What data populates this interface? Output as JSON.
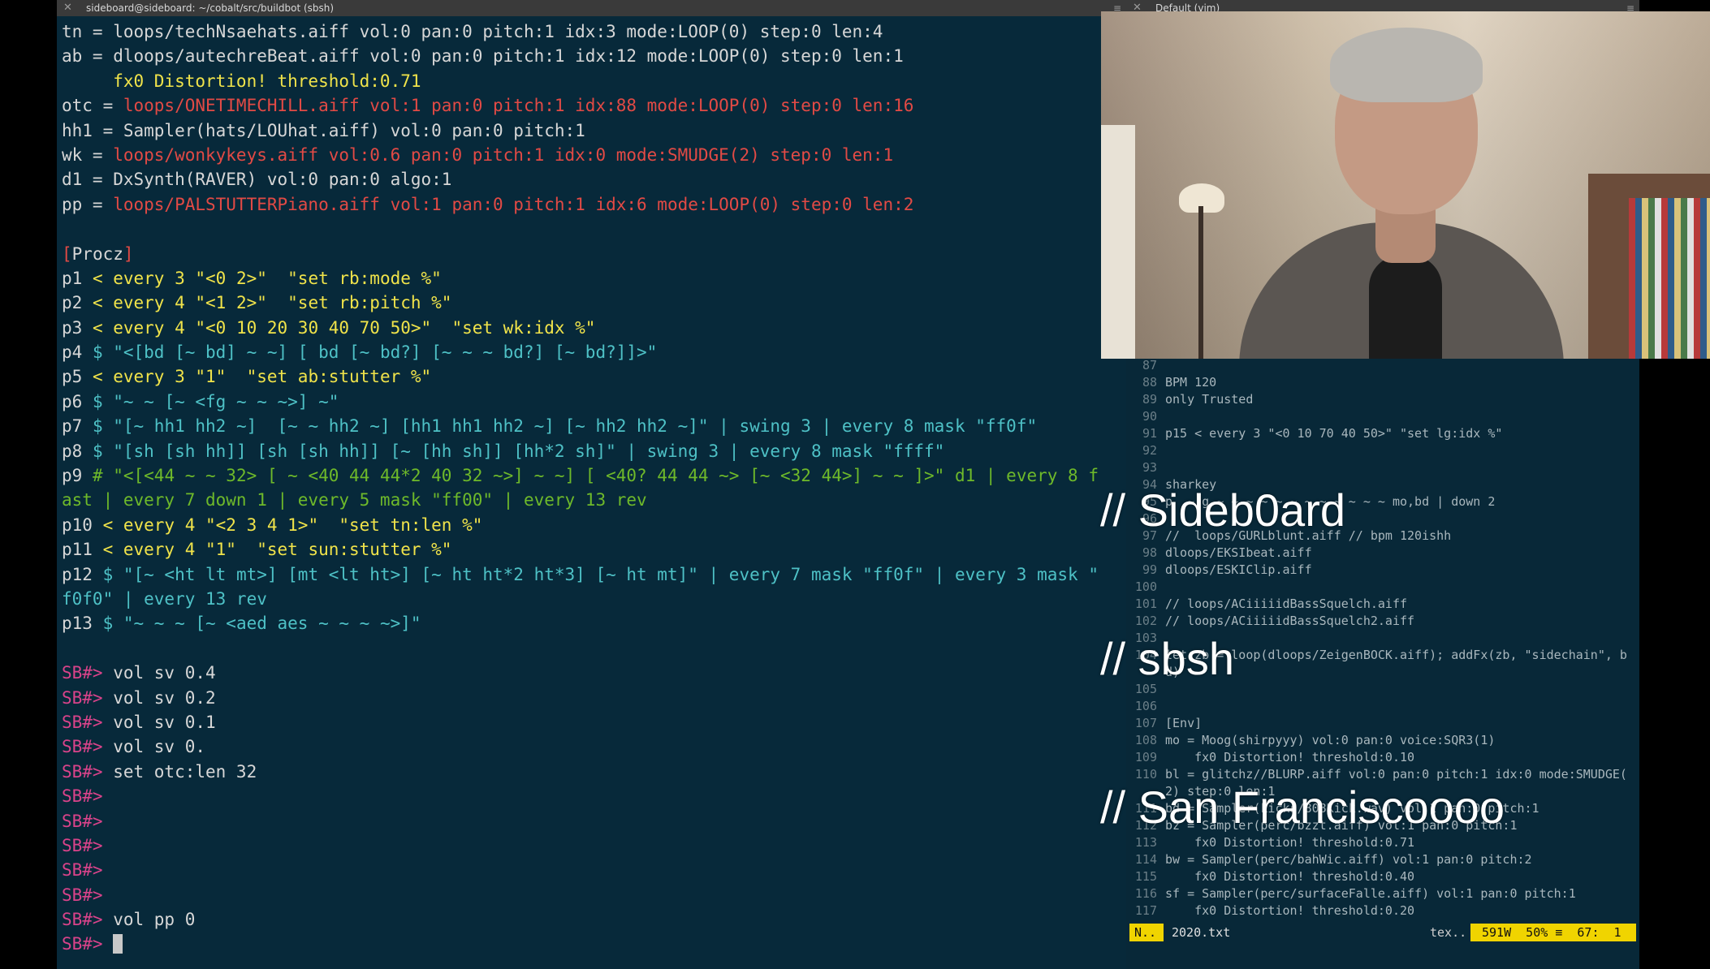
{
  "terminal": {
    "title": "sideboard@sideboard: ~/cobalt/src/buildbot (sbsh)",
    "lines": [
      [
        {
          "t": "tn = ",
          "c": "w"
        },
        {
          "t": "loops/techNsaehats.aiff vol:0 pan:0 pitch:1 idx:3 mode:LOOP(0) step:0 len:4",
          "c": "w"
        }
      ],
      [
        {
          "t": "ab = ",
          "c": "w"
        },
        {
          "t": "dloops/autechreBeat.aiff vol:0 pan:0 pitch:1 idx:12 mode:LOOP(0) step:0 len:1",
          "c": "w"
        }
      ],
      [
        {
          "t": "     fx0 Distortion! threshold:0.71",
          "c": "y"
        }
      ],
      [
        {
          "t": "otc = ",
          "c": "w"
        },
        {
          "t": "loops/ONETIMECHILL.aiff vol:1 pan:0 pitch:1 idx:88 mode:LOOP(0) step:0 len:16",
          "c": "r"
        }
      ],
      [
        {
          "t": "hh1 = Sampler(hats/LOUhat.aiff) vol:0 pan:0 pitch:1",
          "c": "w"
        }
      ],
      [
        {
          "t": "wk = ",
          "c": "w"
        },
        {
          "t": "loops/wonkykeys.aiff vol:0.6 pan:0 pitch:1 idx:0 mode:SMUDGE(2) step:0 len:1",
          "c": "r"
        }
      ],
      [
        {
          "t": "d1 = DxSynth(RAVER) vol:0 pan:0 algo:1",
          "c": "w"
        }
      ],
      [
        {
          "t": "pp = ",
          "c": "w"
        },
        {
          "t": "loops/PALSTUTTERPiano.aiff vol:1 pan:0 pitch:1 idx:6 mode:LOOP(0) step:0 len:2",
          "c": "r"
        }
      ],
      [
        {
          "t": "",
          "c": "w"
        }
      ],
      [
        {
          "t": "[",
          "c": "r"
        },
        {
          "t": "Procz",
          "c": "w"
        },
        {
          "t": "]",
          "c": "r"
        }
      ],
      [
        {
          "t": "p1 ",
          "c": "w"
        },
        {
          "t": "< every 3 \"<0 2>\"  \"set rb:mode %\"",
          "c": "y"
        }
      ],
      [
        {
          "t": "p2 ",
          "c": "w"
        },
        {
          "t": "< every 4 \"<1 2>\"  \"set rb:pitch %\"",
          "c": "y"
        }
      ],
      [
        {
          "t": "p3 ",
          "c": "w"
        },
        {
          "t": "< every 4 \"<0 10 20 30 40 70 50>\"  \"set wk:idx %\"",
          "c": "y"
        }
      ],
      [
        {
          "t": "p4 ",
          "c": "w"
        },
        {
          "t": "$ \"<[bd [~ bd] ~ ~] [ bd [~ bd?] [~ ~ ~ bd?] [~ bd?]]>\"",
          "c": "c"
        }
      ],
      [
        {
          "t": "p5 ",
          "c": "w"
        },
        {
          "t": "< every 3 \"1\"  \"set ab:stutter %\"",
          "c": "y"
        }
      ],
      [
        {
          "t": "p6 ",
          "c": "w"
        },
        {
          "t": "$ \"~ ~ [~ <fg ~ ~ ~>] ~\"",
          "c": "c"
        }
      ],
      [
        {
          "t": "p7 ",
          "c": "w"
        },
        {
          "t": "$ \"[~ hh1 hh2 ~]  [~ ~ hh2 ~] [hh1 hh1 hh2 ~] [~ hh2 hh2 ~]\" | swing 3 | every 8 mask \"ff0f\"",
          "c": "c"
        }
      ],
      [
        {
          "t": "p8 ",
          "c": "w"
        },
        {
          "t": "$ \"[sh [sh hh]] [sh [sh hh]] [~ [hh sh]] [hh*2 sh]\" | swing 3 | every 8 mask \"ffff\"",
          "c": "c"
        }
      ],
      [
        {
          "t": "p9 ",
          "c": "w"
        },
        {
          "t": "# \"<[<44 ~ ~ 32> [ ~ <40 44 44*2 40 32 ~>] ~ ~] [ <40? 44 44 ~> [~ <32 44>] ~ ~ ]>\" d1 | every 8 f",
          "c": "g"
        }
      ],
      [
        {
          "t": "ast | every 7 down 1 | every 5 mask \"ff00\" | every 13 rev",
          "c": "g"
        }
      ],
      [
        {
          "t": "p10 ",
          "c": "w"
        },
        {
          "t": "< every 4 \"<2 3 4 1>\"  \"set tn:len %\"",
          "c": "y"
        }
      ],
      [
        {
          "t": "p11 ",
          "c": "w"
        },
        {
          "t": "< every 4 \"1\"  \"set sun:stutter %\"",
          "c": "y"
        }
      ],
      [
        {
          "t": "p12 ",
          "c": "w"
        },
        {
          "t": "$ \"[~ <ht lt mt>] [mt <lt ht>] [~ ht ht*2 ht*3] [~ ht mt]\" | every 7 mask \"ff0f\" | every 3 mask \"",
          "c": "c"
        }
      ],
      [
        {
          "t": "f0f0\" | every 13 rev",
          "c": "c"
        }
      ],
      [
        {
          "t": "p13 ",
          "c": "w"
        },
        {
          "t": "$ \"~ ~ ~ [~ <aed aes ~ ~ ~ ~>]\"",
          "c": "c"
        }
      ],
      [
        {
          "t": "",
          "c": "w"
        }
      ],
      [
        {
          "t": "SB#> ",
          "c": "p"
        },
        {
          "t": "vol sv 0.4",
          "c": "w"
        }
      ],
      [
        {
          "t": "SB#> ",
          "c": "p"
        },
        {
          "t": "vol sv 0.2",
          "c": "w"
        }
      ],
      [
        {
          "t": "SB#> ",
          "c": "p"
        },
        {
          "t": "vol sv 0.1",
          "c": "w"
        }
      ],
      [
        {
          "t": "SB#> ",
          "c": "p"
        },
        {
          "t": "vol sv 0.",
          "c": "w"
        }
      ],
      [
        {
          "t": "SB#> ",
          "c": "p"
        },
        {
          "t": "set otc:len 32",
          "c": "w"
        }
      ],
      [
        {
          "t": "SB#> ",
          "c": "p"
        }
      ],
      [
        {
          "t": "SB#> ",
          "c": "p"
        }
      ],
      [
        {
          "t": "SB#> ",
          "c": "p"
        }
      ],
      [
        {
          "t": "SB#> ",
          "c": "p"
        }
      ],
      [
        {
          "t": "SB#> ",
          "c": "p"
        }
      ],
      [
        {
          "t": "SB#> ",
          "c": "p"
        },
        {
          "t": "vol pp 0",
          "c": "w"
        }
      ],
      [
        {
          "t": "SB#> ",
          "c": "p"
        },
        {
          "cursor": true
        }
      ]
    ]
  },
  "editor": {
    "title": "Default (vim)",
    "lines": [
      {
        "n": "87",
        "t": ""
      },
      {
        "n": "88",
        "t": "BPM 120"
      },
      {
        "n": "89",
        "t": "only Trusted"
      },
      {
        "n": "90",
        "t": ""
      },
      {
        "n": "91",
        "t": "p15 < every 3 \"<0 10 70 40 50>\" \"set lg:idx %\""
      },
      {
        "n": "92",
        "t": ""
      },
      {
        "n": "93",
        "t": ""
      },
      {
        "n": "94",
        "t": "sharkey"
      },
      {
        "n": "95",
        "t": "p  ~ g ~ ~ ~ ~ ~ ~ ~ ~ ~ ~ ~ ~ mo,bd | down 2"
      },
      {
        "n": "96",
        "t": ""
      },
      {
        "n": "97",
        "t": "//  loops/GURLblunt.aiff // bpm 120ishh"
      },
      {
        "n": "98",
        "t": "dloops/EKSIbeat.aiff"
      },
      {
        "n": "99",
        "t": "dloops/ESKIClip.aiff"
      },
      {
        "n": "100",
        "t": ""
      },
      {
        "n": "101",
        "t": "// loops/ACiiiiidBassSquelch.aiff"
      },
      {
        "n": "102",
        "t": "// loops/ACiiiiidBassSquelch2.aiff"
      },
      {
        "n": "103",
        "t": ""
      },
      {
        "n": "104",
        "t": "let zb = loop(dloops/ZeigenBOCK.aiff); addFx(zb, \"sidechain\", b"
      },
      {
        "n": "",
        "t": "d)"
      },
      {
        "n": "105",
        "t": ""
      },
      {
        "n": "106",
        "t": ""
      },
      {
        "n": "107",
        "t": "[Env]"
      },
      {
        "n": "108",
        "t": "mo = Moog(shirpyyy) vol:0 pan:0 voice:SQR3(1)"
      },
      {
        "n": "109",
        "t": "    fx0 Distortion! threshold:0.10"
      },
      {
        "n": "110",
        "t": "bl = glitchz//BLURP.aiff vol:0 pan:0 pitch:1 idx:0 mode:SMUDGE("
      },
      {
        "n": "",
        "t": "2) step:0 len:1"
      },
      {
        "n": "111",
        "t": "bd = Sampler(kicks/808Kick.wav) vol:1 pan:0 pitch:1"
      },
      {
        "n": "112",
        "t": "bz = Sampler(perc/bzzt.aiff) vol:1 pan:0 pitch:1"
      },
      {
        "n": "113",
        "t": "    fx0 Distortion! threshold:0.71"
      },
      {
        "n": "114",
        "t": "bw = Sampler(perc/bahWic.aiff) vol:1 pan:0 pitch:2"
      },
      {
        "n": "115",
        "t": "    fx0 Distortion! threshold:0.40"
      },
      {
        "n": "116",
        "t": "sf = Sampler(perc/surfaceFalle.aiff) vol:1 pan:0 pitch:1"
      },
      {
        "n": "117",
        "t": "    fx0 Distortion! threshold:0.20"
      }
    ],
    "status": {
      "mode": "N..",
      "file": "2020.txt",
      "filetype": "tex..",
      "right": "591W  50% ≡  67:  1"
    }
  },
  "overlay": {
    "lines": [
      "// Sideb0ard",
      "// sbsh",
      "// San Franciscoooo"
    ]
  },
  "colors": {
    "w": "#d7d7d7",
    "r": "#e24a45",
    "y": "#f0e34a",
    "g": "#6eb92a",
    "c": "#4ec1c6",
    "p": "#d9438a"
  }
}
